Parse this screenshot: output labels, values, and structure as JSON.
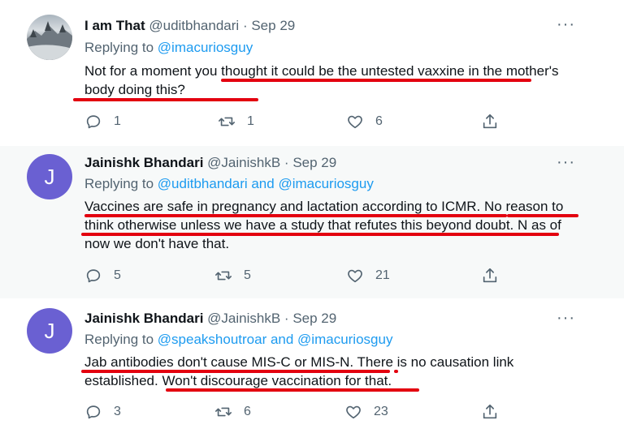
{
  "tweets": [
    {
      "name": "I am That",
      "handle": "@uditbhandari",
      "separator": "·",
      "date": "Sep 29",
      "avatar": "landscape-photo",
      "replying_prefix": "Replying to",
      "replying_to": "@imacuriosguy",
      "body": "Not for a moment you thought it could be the untested vaxxine in the mother's body doing this?",
      "counts": {
        "reply": "1",
        "retweet": "1",
        "like": "6"
      }
    },
    {
      "name": "Jainishk Bhandari",
      "handle": "@JainishkB",
      "separator": "·",
      "date": "Sep 29",
      "avatar_letter": "J",
      "replying_prefix": "Replying to",
      "replying_to": "@uditbhandari and @imacuriosguy",
      "body": "Vaccines are safe in pregnancy and lactation according to ICMR. No reason to think otherwise unless we have a study that refutes this beyond doubt. N as of now we don't have that.",
      "counts": {
        "reply": "5",
        "retweet": "5",
        "like": "21"
      }
    },
    {
      "name": "Jainishk Bhandari",
      "handle": "@JainishkB",
      "separator": "·",
      "date": "Sep 29",
      "avatar_letter": "J",
      "replying_prefix": "Replying to",
      "replying_to": "@speakshoutroar and @imacuriosguy",
      "body": "Jab antibodies don't cause MIS-C or MIS-N. There is no causation link established. Won't discourage vaccination for that.",
      "counts": {
        "reply": "3",
        "retweet": "6",
        "like": "23"
      }
    }
  ],
  "more_glyph": "···",
  "colors": {
    "link": "#1d9bf0",
    "secondary": "#536471",
    "underline_annotation": "#e3000f",
    "avatar_purple": "#6a60d2",
    "highlight_bg": "#f7f9f9"
  },
  "icons": [
    "reply-icon",
    "retweet-icon",
    "like-icon",
    "share-icon",
    "more-icon"
  ]
}
